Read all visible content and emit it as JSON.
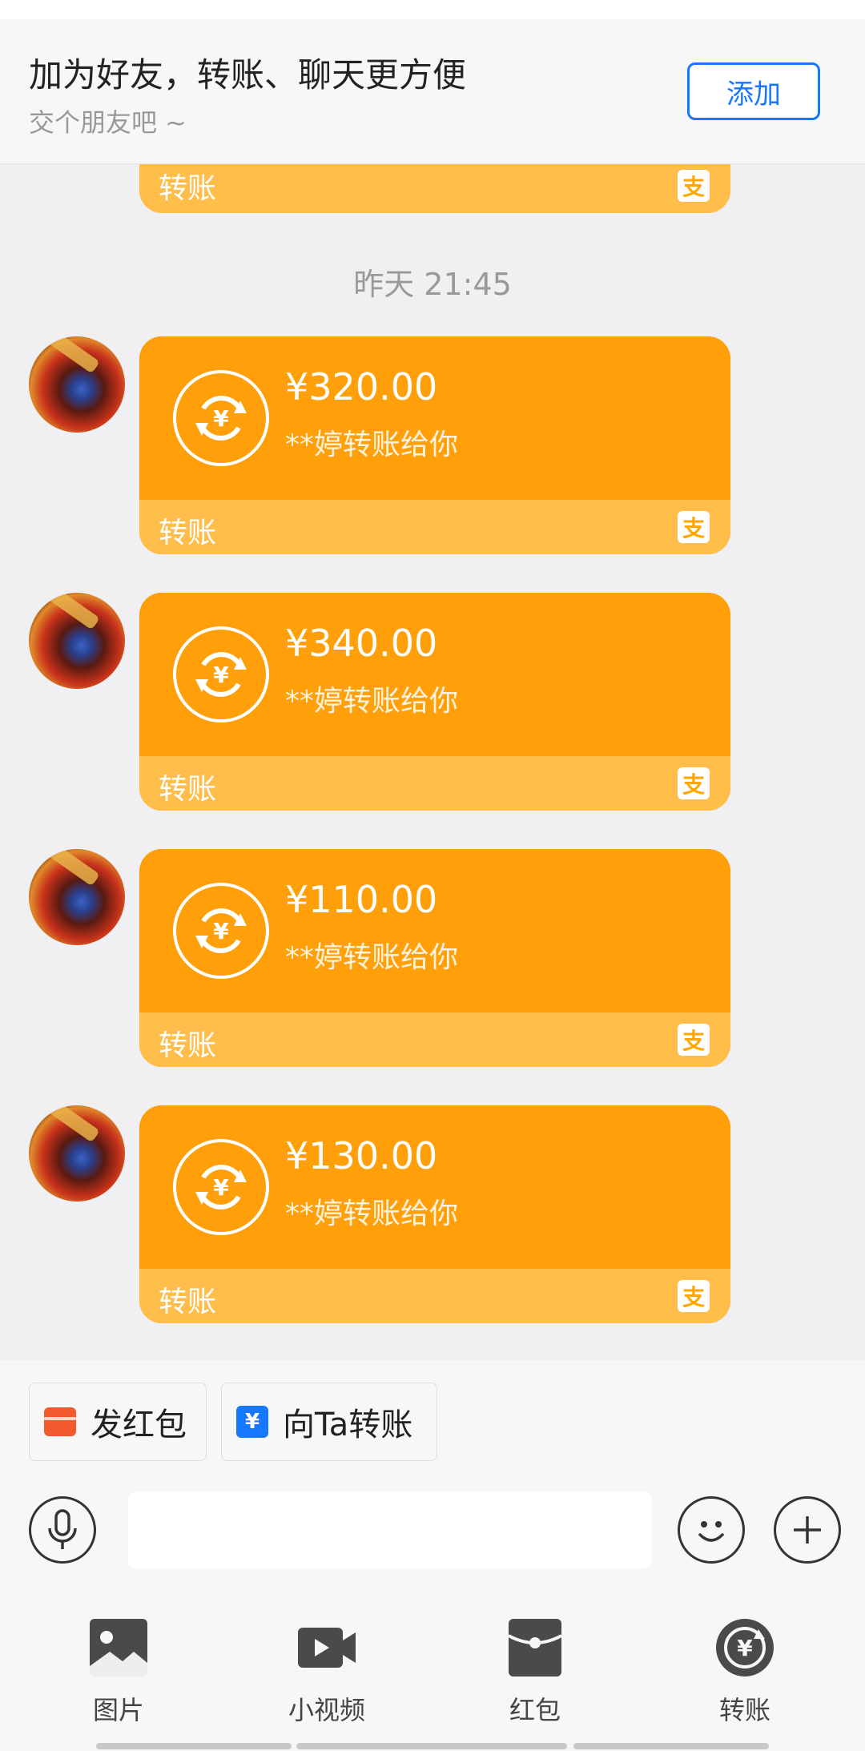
{
  "banner": {
    "title": "加为好友，转账、聊天更方便",
    "subtitle": "交个朋友吧 ~",
    "add_label": "添加"
  },
  "partial_card": {
    "footer_label": "转账",
    "badge": "支"
  },
  "timestamp": "昨天 21:45",
  "transfers": [
    {
      "amount": "¥320.00",
      "desc": "**婷转账给你",
      "footer_label": "转账",
      "badge": "支"
    },
    {
      "amount": "¥340.00",
      "desc": "**婷转账给你",
      "footer_label": "转账",
      "badge": "支"
    },
    {
      "amount": "¥110.00",
      "desc": "**婷转账给你",
      "footer_label": "转账",
      "badge": "支"
    },
    {
      "amount": "¥130.00",
      "desc": "**婷转账给你",
      "footer_label": "转账",
      "badge": "支"
    }
  ],
  "quick_actions": {
    "red_packet": "发红包",
    "transfer": "向Ta转账",
    "transfer_icon_glyph": "¥"
  },
  "input": {
    "value": "",
    "placeholder": ""
  },
  "toolbar": [
    {
      "label": "图片",
      "icon": "image-icon"
    },
    {
      "label": "小视频",
      "icon": "video-icon"
    },
    {
      "label": "红包",
      "icon": "red-packet-icon"
    },
    {
      "label": "转账",
      "icon": "transfer-icon"
    }
  ],
  "colors": {
    "card": "#ff9f0a",
    "card_footer": "#ffbd4a",
    "accent_blue": "#1677ff",
    "red_packet": "#f25a2e"
  }
}
